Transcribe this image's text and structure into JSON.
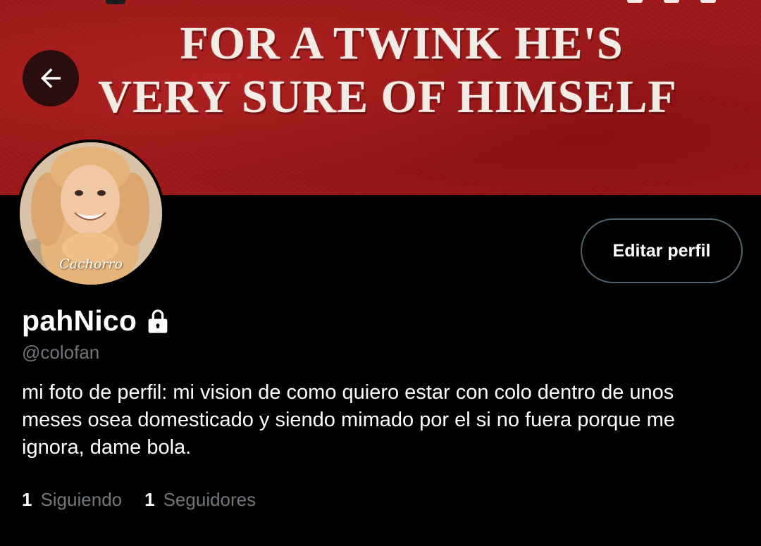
{
  "banner": {
    "line1": "FOR A TWINK HE'S",
    "line2": "VERY SURE OF HIMSELF",
    "color": "#9a1717"
  },
  "nav": {
    "back_icon": "arrow-left-icon"
  },
  "profile": {
    "avatar_caption": "Cachorro",
    "display_name": "pahNico",
    "lock_icon": "lock-icon",
    "handle": "@colofan",
    "bio": "mi foto de perfil: mi vision de como quiero estar con colo dentro de unos meses osea domesticado y siendo mimado por el si no fuera porque me ignora, dame bola.",
    "edit_button_label": "Editar perfil"
  },
  "stats": {
    "following_count": "1",
    "following_label": "Siguiendo",
    "followers_count": "1",
    "followers_label": "Seguidores"
  },
  "colors": {
    "background": "#000000",
    "text_primary": "#ffffff",
    "text_secondary": "#71767b",
    "button_border": "#536471"
  }
}
